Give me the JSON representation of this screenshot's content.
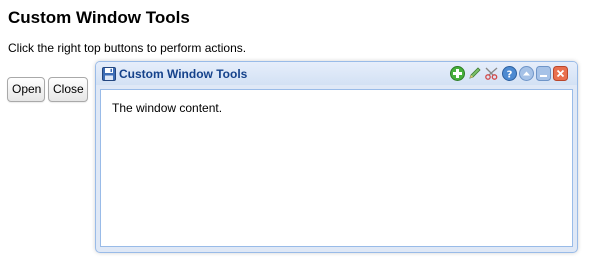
{
  "page": {
    "title": "Custom Window Tools",
    "description": "Click the right top buttons to perform actions."
  },
  "buttons": {
    "open_label": "Open",
    "close_label": "Close"
  },
  "window": {
    "title": "Custom Window Tools",
    "content": "The window content.",
    "icon": "save-disk-icon",
    "tools": [
      {
        "name": "add",
        "icon": "plus-icon",
        "color": "#3fa535"
      },
      {
        "name": "edit",
        "icon": "pencil-icon",
        "color": "#6aa84f"
      },
      {
        "name": "cut",
        "icon": "scissors-icon",
        "color": "#cc4444"
      },
      {
        "name": "help",
        "icon": "question-icon",
        "color": "#4a86c8"
      },
      {
        "name": "collapse",
        "icon": "chevron-up-icon",
        "color": "#8fb2de"
      },
      {
        "name": "minimize",
        "icon": "minimize-icon",
        "color": "#8fb2de"
      },
      {
        "name": "close",
        "icon": "close-icon",
        "color": "#e8694e"
      }
    ]
  },
  "colors": {
    "window_border": "#99bbe8",
    "window_title": "#15428b",
    "window_frame": "#dfe8f6"
  }
}
